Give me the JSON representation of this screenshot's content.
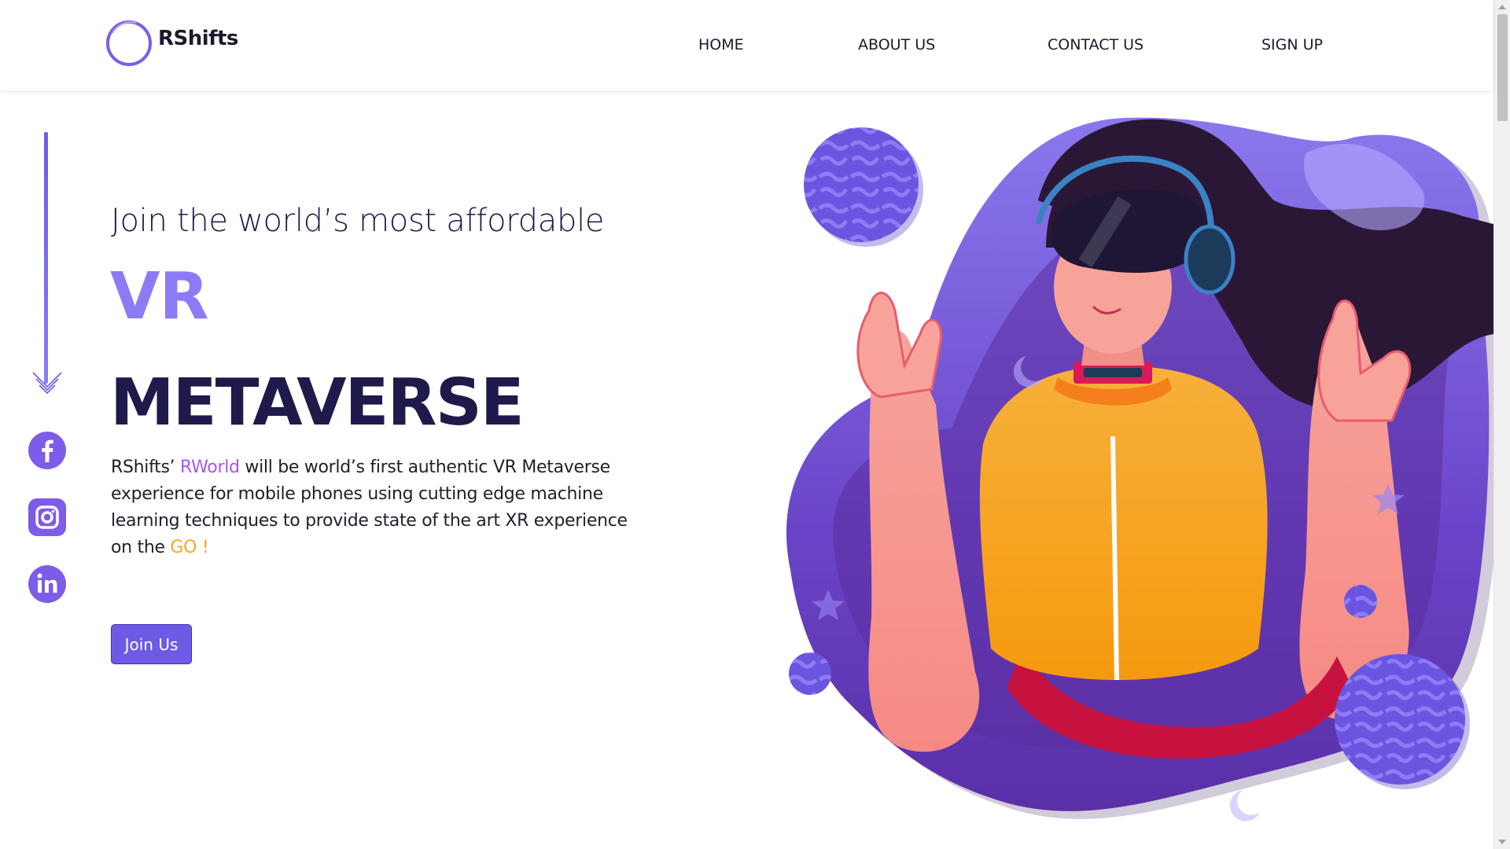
{
  "brand": {
    "name": "RShifts"
  },
  "nav": {
    "home": "HOME",
    "about": "ABOUT US",
    "contact": "CONTACT US",
    "signup": "SIGN UP"
  },
  "hero": {
    "subtitle": "Join the world’s most affordable",
    "title_line1": "VR",
    "title_line2": "METAVERSE",
    "desc_part1": "RShifts’ ",
    "desc_highlight": "RWorld",
    "desc_part2": " will be world’s first authentic VR Metaverse experience for mobile phones using cutting edge machine learning techniques to provide state of the art XR experience on the ",
    "desc_go": "GO !",
    "cta": "Join Us"
  },
  "social": [
    "facebook-icon",
    "instagram-icon",
    "linkedin-icon"
  ],
  "colors": {
    "accent": "#8b7cf6",
    "primary_button": "#6d5be6",
    "dark_text": "#1e1b4b",
    "highlight_purple": "#a855f7",
    "highlight_orange": "#f5a623"
  }
}
